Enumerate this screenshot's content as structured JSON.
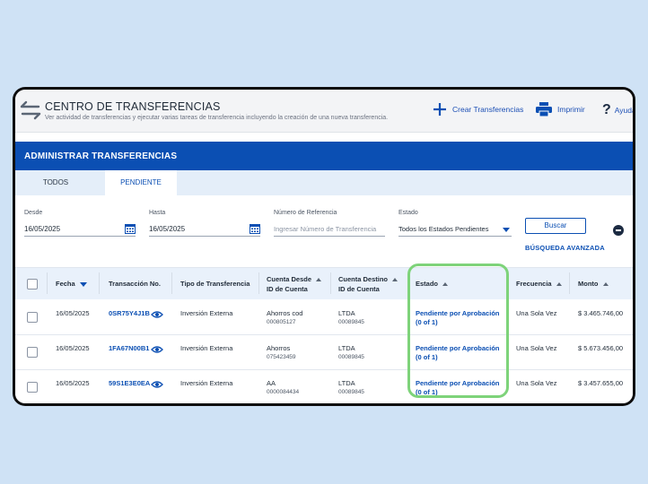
{
  "header": {
    "title": "CENTRO DE TRANSFERENCIAS",
    "subtitle": "Ver actividad de transferencias y ejecutar varias tareas de transferencia incluyendo la creación de una nueva transferencia.",
    "actions": {
      "create": "Crear Transferencias",
      "print": "Imprimir",
      "help": "Ayuda"
    }
  },
  "section": {
    "title": "ADMINISTRAR TRANSFERENCIAS"
  },
  "tabs": [
    {
      "label": "TODOS",
      "active": false
    },
    {
      "label": "PENDIENTE",
      "active": true
    }
  ],
  "filters": {
    "desde": {
      "label": "Desde",
      "value": "16/05/2025"
    },
    "hasta": {
      "label": "Hasta",
      "value": "16/05/2025"
    },
    "referencia": {
      "label": "Número de Referencia",
      "placeholder": "Ingresar Número de Transferencia"
    },
    "estado": {
      "label": "Estado",
      "value": "Todos los Estados Pendientes"
    },
    "search_button": "Buscar",
    "advanced_search": "BÚSQUEDA AVANZADA"
  },
  "table": {
    "headers": {
      "fecha": "Fecha",
      "transaccion": "Transacción No.",
      "tipo": "Tipo de Transferencia",
      "cuenta_desde": "Cuenta Desde",
      "cuenta_desde_sub": "ID de Cuenta",
      "cuenta_destino": "Cuenta Destino",
      "cuenta_destino_sub": "ID de Cuenta",
      "estado": "Estado",
      "frecuencia": "Frecuencia",
      "monto": "Monto"
    },
    "rows": [
      {
        "fecha": "16/05/2025",
        "transaccion": "0SR75Y4J1B",
        "tipo": "Inversión Externa",
        "desde_nombre": "Ahorros cod",
        "desde_id": "000805127",
        "destino_nombre": "LTDA",
        "destino_id": "00089845",
        "estado_1": "Pendiente por Aprobación",
        "estado_2": "(0 of 1)",
        "frecuencia": "Una Sola Vez",
        "monto": "$ 3.465.746,00"
      },
      {
        "fecha": "16/05/2025",
        "transaccion": "1FA67N00B1",
        "tipo": "Inversión Externa",
        "desde_nombre": "Ahorros",
        "desde_id": "075423459",
        "destino_nombre": "LTDA",
        "destino_id": "00089845",
        "estado_1": "Pendiente por Aprobación",
        "estado_2": "(0 of 1)",
        "frecuencia": "Una Sola Vez",
        "monto": "$ 5.673.456,00"
      },
      {
        "fecha": "16/05/2025",
        "transaccion": "59S1E3E0EA",
        "tipo": "Inversión Externa",
        "desde_nombre": "AA",
        "desde_id": "0000084434",
        "destino_nombre": "LTDA",
        "destino_id": "00089845",
        "estado_1": "Pendiente por Aprobación",
        "estado_2": "(0 of 1)",
        "frecuencia": "Una Sola Vez",
        "monto": "$ 3.457.655,00"
      }
    ]
  },
  "colors": {
    "primary": "#0b4fb3",
    "highlight": "#7ed37a",
    "background": "#cfe2f5"
  }
}
